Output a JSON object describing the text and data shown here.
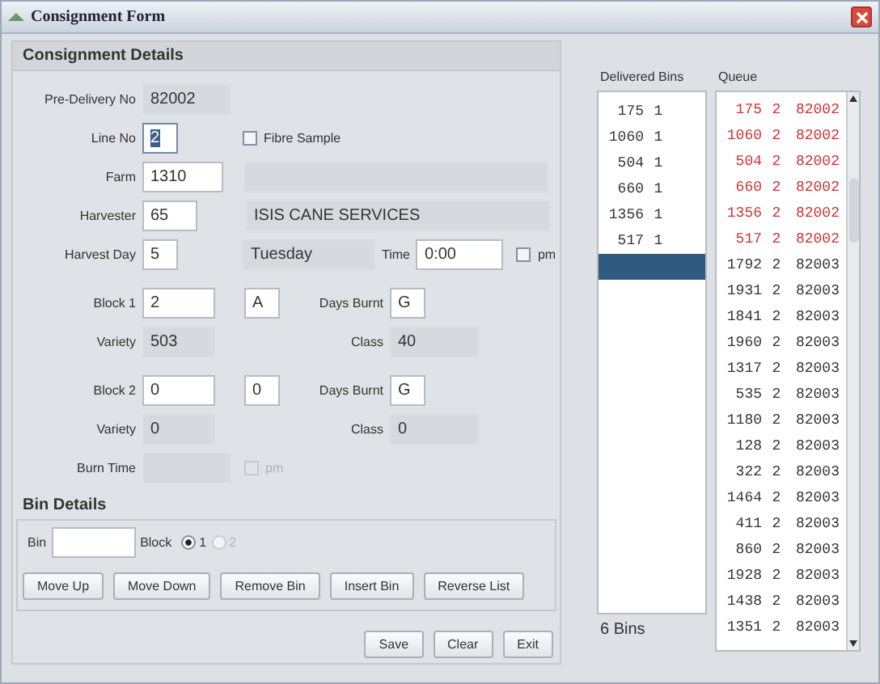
{
  "window": {
    "title": "Consignment Form"
  },
  "details": {
    "title": "Consignment Details",
    "pre_delivery_no": {
      "label": "Pre-Delivery No",
      "value": "82002"
    },
    "line_no": {
      "label": "Line No",
      "value": "2",
      "focused": true
    },
    "fibre_sample": {
      "label": "Fibre Sample",
      "checked": false
    },
    "farm": {
      "label": "Farm",
      "value": "1310"
    },
    "harvester": {
      "label": "Harvester",
      "value": "65",
      "name": "ISIS CANE SERVICES"
    },
    "harvest_day": {
      "label": "Harvest Day",
      "value": "5",
      "day_name": "Tuesday"
    },
    "time": {
      "label": "Time",
      "value": "0:00"
    },
    "time_pm": {
      "label": "pm",
      "checked": false,
      "disabled": false
    },
    "blocks": [
      {
        "label": "Block 1",
        "value": "2",
        "code": "A",
        "days_burnt_label": "Days Burnt",
        "days_burnt": "G",
        "variety_label": "Variety",
        "variety": "503",
        "class_label": "Class",
        "class": "40"
      },
      {
        "label": "Block 2",
        "value": "0",
        "code": "0",
        "days_burnt_label": "Days Burnt",
        "days_burnt": "G",
        "variety_label": "Variety",
        "variety": "0",
        "class_label": "Class",
        "class": "0"
      }
    ],
    "burn_time": {
      "label": "Burn Time",
      "disabled": true
    },
    "burn_pm": {
      "label": "pm",
      "checked": false,
      "disabled": true
    }
  },
  "bin_details": {
    "title": "Bin Details",
    "bin_label": "Bin",
    "block_label": "Block",
    "block_options": [
      {
        "label": "1",
        "selected": true,
        "disabled": false
      },
      {
        "label": "2",
        "selected": false,
        "disabled": true
      }
    ],
    "buttons": [
      "Move Up",
      "Move Down",
      "Remove Bin",
      "Insert Bin",
      "Reverse List"
    ]
  },
  "actions": [
    "Save",
    "Clear",
    "Exit"
  ],
  "delivered_bins": {
    "title": "Delivered Bins",
    "count": "6 Bins",
    "selected_blank_row": true,
    "rows": [
      {
        "bin": "175",
        "block": "1"
      },
      {
        "bin": "1060",
        "block": "1"
      },
      {
        "bin": "504",
        "block": "1"
      },
      {
        "bin": "660",
        "block": "1"
      },
      {
        "bin": "1356",
        "block": "1"
      },
      {
        "bin": "517",
        "block": "1"
      }
    ]
  },
  "queue": {
    "title": "Queue",
    "rows": [
      {
        "bin": "175",
        "block": "2",
        "delivery": "82002",
        "color": "#cc3333"
      },
      {
        "bin": "1060",
        "block": "2",
        "delivery": "82002",
        "color": "#cc3333"
      },
      {
        "bin": "504",
        "block": "2",
        "delivery": "82002",
        "color": "#cc3333"
      },
      {
        "bin": "660",
        "block": "2",
        "delivery": "82002",
        "color": "#cc3333"
      },
      {
        "bin": "1356",
        "block": "2",
        "delivery": "82002",
        "color": "#cc3333"
      },
      {
        "bin": "517",
        "block": "2",
        "delivery": "82002",
        "color": "#cc3333"
      },
      {
        "bin": "1792",
        "block": "2",
        "delivery": "82003",
        "color": "#333333"
      },
      {
        "bin": "1931",
        "block": "2",
        "delivery": "82003",
        "color": "#333333"
      },
      {
        "bin": "1841",
        "block": "2",
        "delivery": "82003",
        "color": "#333333"
      },
      {
        "bin": "1960",
        "block": "2",
        "delivery": "82003",
        "color": "#333333"
      },
      {
        "bin": "1317",
        "block": "2",
        "delivery": "82003",
        "color": "#333333"
      },
      {
        "bin": "535",
        "block": "2",
        "delivery": "82003",
        "color": "#333333"
      },
      {
        "bin": "1180",
        "block": "2",
        "delivery": "82003",
        "color": "#333333"
      },
      {
        "bin": "128",
        "block": "2",
        "delivery": "82003",
        "color": "#333333"
      },
      {
        "bin": "322",
        "block": "2",
        "delivery": "82003",
        "color": "#333333"
      },
      {
        "bin": "1464",
        "block": "2",
        "delivery": "82003",
        "color": "#333333"
      },
      {
        "bin": "411",
        "block": "2",
        "delivery": "82003",
        "color": "#333333"
      },
      {
        "bin": "860",
        "block": "2",
        "delivery": "82003",
        "color": "#333333"
      },
      {
        "bin": "1928",
        "block": "2",
        "delivery": "82003",
        "color": "#333333"
      },
      {
        "bin": "1438",
        "block": "2",
        "delivery": "82003",
        "color": "#333333"
      },
      {
        "bin": "1351",
        "block": "2",
        "delivery": "82003",
        "color": "#333333"
      }
    ]
  }
}
